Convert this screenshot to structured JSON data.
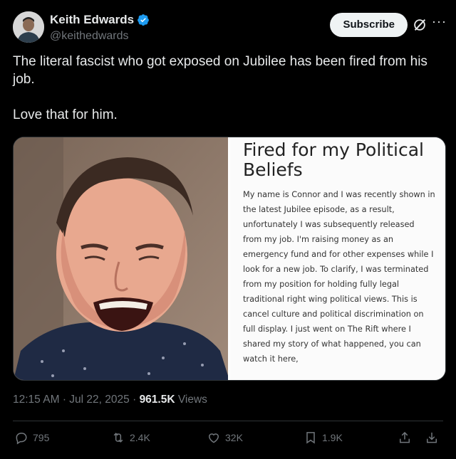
{
  "author": {
    "display_name": "Keith Edwards",
    "handle": "@keithedwards",
    "verified": true
  },
  "header": {
    "subscribe_label": "Subscribe",
    "more_label": "···"
  },
  "tweet": {
    "line1": "The literal fascist who got exposed on Jubilee has been fired from his job.",
    "line2": "Love that for him."
  },
  "media": {
    "fundraiser_title": "Fired for my Political Beliefs",
    "fundraiser_body": "My name is Connor and I was recently shown in the latest Jubilee episode, as a result, unfortunately I was subsequently released from my job. I'm raising money as an emergency fund and for other expenses while I look for a new job. To clarify, I was terminated from my position for holding fully legal traditional right wing political views. This is cancel culture and political discrimination on full display. I just went on The Rift where I shared my story of what happened, you can watch it here,"
  },
  "meta": {
    "time": "12:15 AM",
    "dot": "·",
    "date": "Jul 22, 2025",
    "views_count": "961.5K",
    "views_label": "Views"
  },
  "actions": {
    "replies": "795",
    "reposts": "2.4K",
    "likes": "32K",
    "bookmarks": "1.9K"
  },
  "colors": {
    "background": "#000000",
    "text": "#e7e9ea",
    "muted": "#71767b",
    "verified": "#1d9bf0"
  }
}
